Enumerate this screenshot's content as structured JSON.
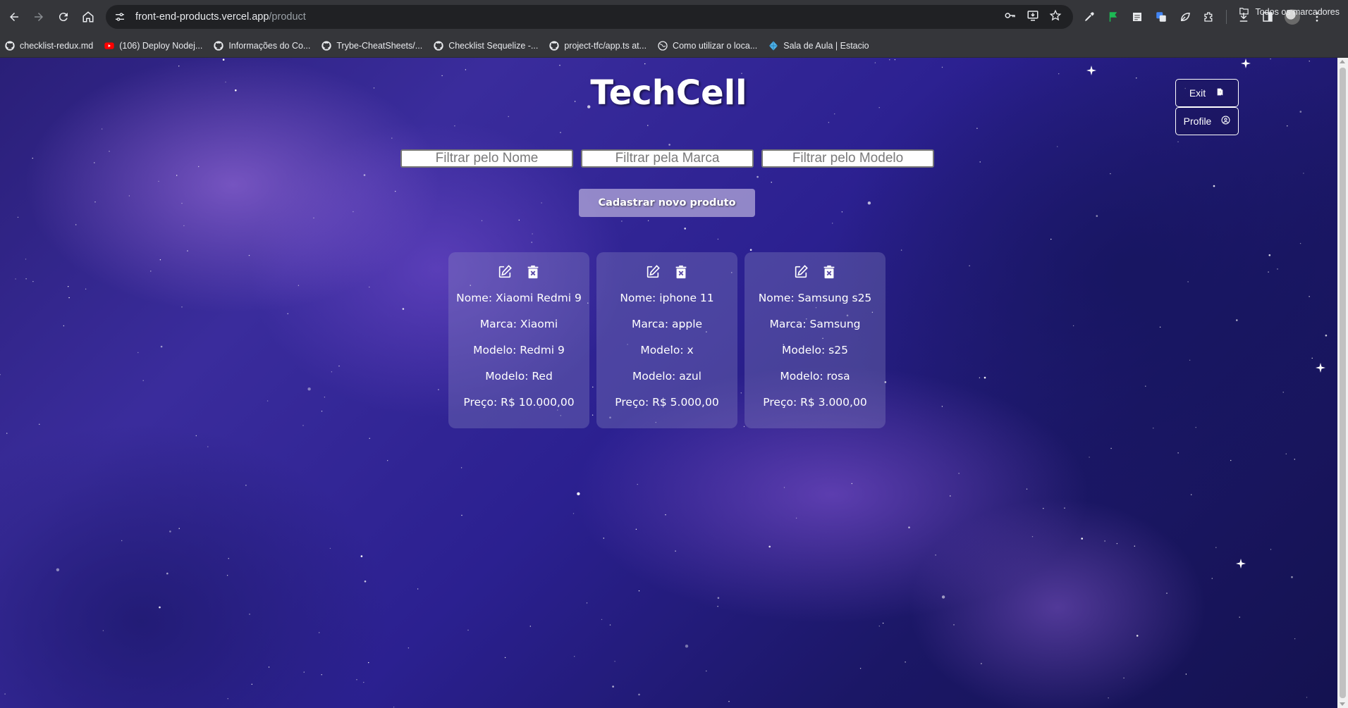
{
  "browser": {
    "url_host": "front-end-products.vercel.app",
    "url_path": "/product",
    "bookmarks": [
      {
        "icon": "github-icon",
        "label": "checklist-redux.md"
      },
      {
        "icon": "youtube-icon",
        "label": "(106) Deploy Nodej..."
      },
      {
        "icon": "github-icon",
        "label": "Informações do Co..."
      },
      {
        "icon": "github-icon",
        "label": "Trybe-CheatSheets/..."
      },
      {
        "icon": "github-icon",
        "label": "Checklist Sequelize -..."
      },
      {
        "icon": "github-icon",
        "label": "project-tfc/app.ts at..."
      },
      {
        "icon": "globe-icon",
        "label": "Como utilizar o loca..."
      },
      {
        "icon": "diamond-icon",
        "label": "Sala de Aula | Estacio"
      }
    ],
    "bookmarks_folder": "Todos os marcadores"
  },
  "page": {
    "title": "TechCell",
    "exit_label": "Exit",
    "profile_label": "Profile",
    "filters": {
      "name_placeholder": "Filtrar pelo Nome",
      "brand_placeholder": "Filtrar pela Marca",
      "model_placeholder": "Filtrar pelo Modelo"
    },
    "add_button": "Cadastrar novo produto"
  },
  "products": [
    {
      "nome": "Nome: Xiaomi Redmi 9",
      "marca": "Marca: Xiaomi",
      "modelo": "Modelo: Redmi 9",
      "cor": "Modelo: Red",
      "preco": "Preço: R$ 10.000,00"
    },
    {
      "nome": "Nome: iphone 11",
      "marca": "Marca: apple",
      "modelo": "Modelo: x",
      "cor": "Modelo: azul",
      "preco": "Preço: R$ 5.000,00"
    },
    {
      "nome": "Nome: Samsung s25",
      "marca": "Marca: Samsung",
      "modelo": "Modelo: s25",
      "cor": "Modelo: rosa",
      "preco": "Preço: R$ 3.000,00"
    }
  ]
}
